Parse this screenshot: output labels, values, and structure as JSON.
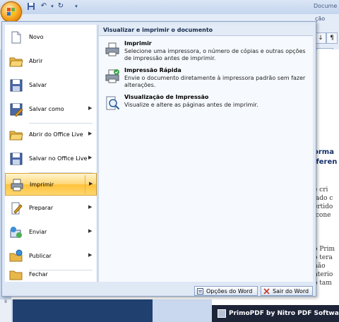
{
  "window": {
    "title_partial": "Docume",
    "ribbon_tab_partial": "ção"
  },
  "menu": {
    "items": [
      {
        "label": "Novo",
        "icon": "new-document-icon",
        "has_submenu": false
      },
      {
        "label": "Abrir",
        "icon": "open-folder-icon",
        "has_submenu": false
      },
      {
        "label": "Salvar",
        "icon": "save-floppy-icon",
        "has_submenu": false
      },
      {
        "label": "Salvar como",
        "icon": "save-as-icon",
        "has_submenu": true
      },
      {
        "label": "Abrir do Office Live",
        "icon": "open-office-live-icon",
        "has_submenu": true
      },
      {
        "label": "Salvar no Office Live",
        "icon": "save-office-live-icon",
        "has_submenu": true
      },
      {
        "label": "Imprimir",
        "icon": "printer-icon",
        "has_submenu": true,
        "selected": true
      },
      {
        "label": "Preparar",
        "icon": "prepare-icon",
        "has_submenu": true
      },
      {
        "label": "Enviar",
        "icon": "send-icon",
        "has_submenu": true
      },
      {
        "label": "Publicar",
        "icon": "publish-icon",
        "has_submenu": true
      },
      {
        "label": "Fechar",
        "icon": "close-folder-icon",
        "has_submenu": false
      }
    ]
  },
  "submenu": {
    "header": "Visualizar e imprimir o documento",
    "options": [
      {
        "title": "Imprimir",
        "desc": "Selecione uma impressora, o número de cópias e outras opções de impressão antes de imprimir.",
        "icon": "printer-icon"
      },
      {
        "title": "Impressão Rápida",
        "desc": "Envie o documento diretamente à impressora padrão sem fazer alterações.",
        "icon": "quick-print-icon"
      },
      {
        "title": "Visualização de Impressão",
        "desc": "Visualize e altere as páginas antes de imprimir.",
        "icon": "print-preview-icon"
      }
    ]
  },
  "footer": {
    "word_options": "Opções do Word",
    "exit_word": "Sair do Word"
  },
  "doc_fragments": [
    "orma",
    "iferen",
    "e cri",
    "lado c",
    "ertido",
    "icone",
    "o Prim",
    "o tera",
    "não",
    "nterio",
    "o tam"
  ],
  "primopdf": "PrimoPDF by Nitro PDF Software",
  "colors": {
    "menu_bg": "#dfe8f5",
    "selection": "#ffd877",
    "title_bar": "#c3d5ee"
  }
}
